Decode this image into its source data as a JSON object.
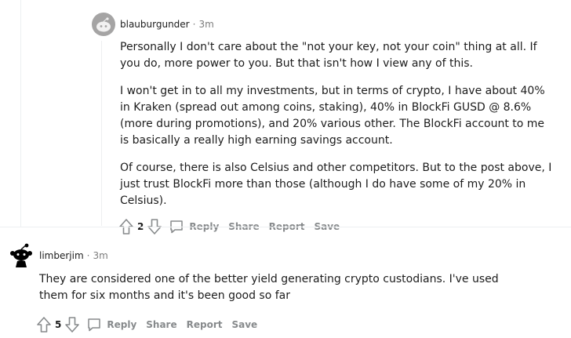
{
  "comments": [
    {
      "author": "blauburgunder",
      "separator": "·",
      "time": "3m",
      "paragraphs": [
        "Personally I don't care about the \"not your key, not your coin\" thing at all. If you do, more power to you. But that isn't how I view any of this.",
        "I won't get in to all my investments, but in terms of crypto, I have about 40% in Kraken (spread out among coins, staking), 40% in BlockFi GUSD @ 8.6% (more during promotions), and 20% various other. The BlockFi account to me is basically a really high earning savings account.",
        "Of course, there is also Celsius and other competitors. But to the post above, I just trust BlockFi more than those (although I do have some of my 20% in Celsius)."
      ],
      "score": "2",
      "actions": {
        "reply": "Reply",
        "share": "Share",
        "report": "Report",
        "save": "Save"
      },
      "avatar_color": "#a5a4a4"
    },
    {
      "author": "limberjim",
      "separator": "·",
      "time": "3m",
      "paragraphs": [
        "They are considered one of the better yield generating crypto custodians. I've used them for six months and it's been good so far"
      ],
      "score": "5",
      "actions": {
        "reply": "Reply",
        "share": "Share",
        "report": "Report",
        "save": "Save"
      },
      "avatar_color": "#000000"
    }
  ],
  "colors": {
    "muted": "#878a8c",
    "text": "#1c1c1c",
    "divider": "#edeff1"
  }
}
